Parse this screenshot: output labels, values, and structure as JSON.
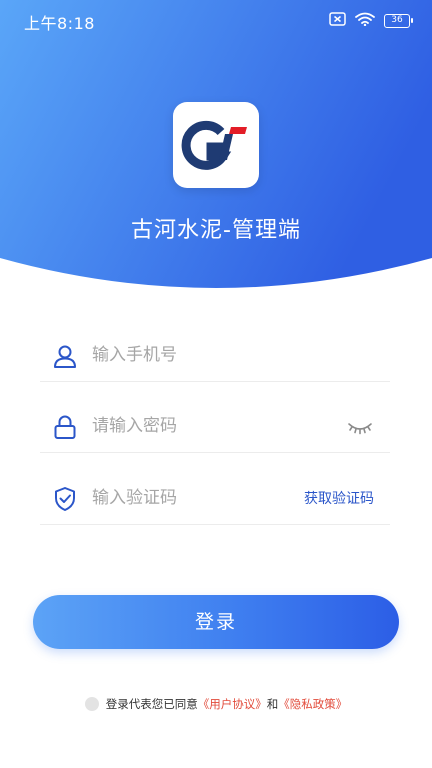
{
  "status_bar": {
    "time": "上午8:18",
    "battery": "36"
  },
  "app": {
    "title": "古河水泥-管理端"
  },
  "form": {
    "phone_placeholder": "输入手机号",
    "password_placeholder": "请输入密码",
    "code_placeholder": "输入验证码",
    "get_code_label": "获取验证码"
  },
  "login_button": {
    "label": "登录"
  },
  "agreement": {
    "prefix": "登录代表您已同意",
    "user_agreement": "《用户协议》",
    "connector": "和",
    "privacy_policy": "《隐私政策》"
  },
  "colors": {
    "header_gradient_start": "#5aa6f8",
    "header_gradient_end": "#2f5fe3",
    "accent": "#2b56c9",
    "link_red": "#e24b3b"
  },
  "icons": {
    "status": [
      "sim-off-icon",
      "wifi-icon",
      "battery-icon"
    ],
    "fields": [
      "user-icon",
      "lock-icon",
      "shield-check-icon"
    ],
    "password_toggle": "eye-closed-icon"
  }
}
